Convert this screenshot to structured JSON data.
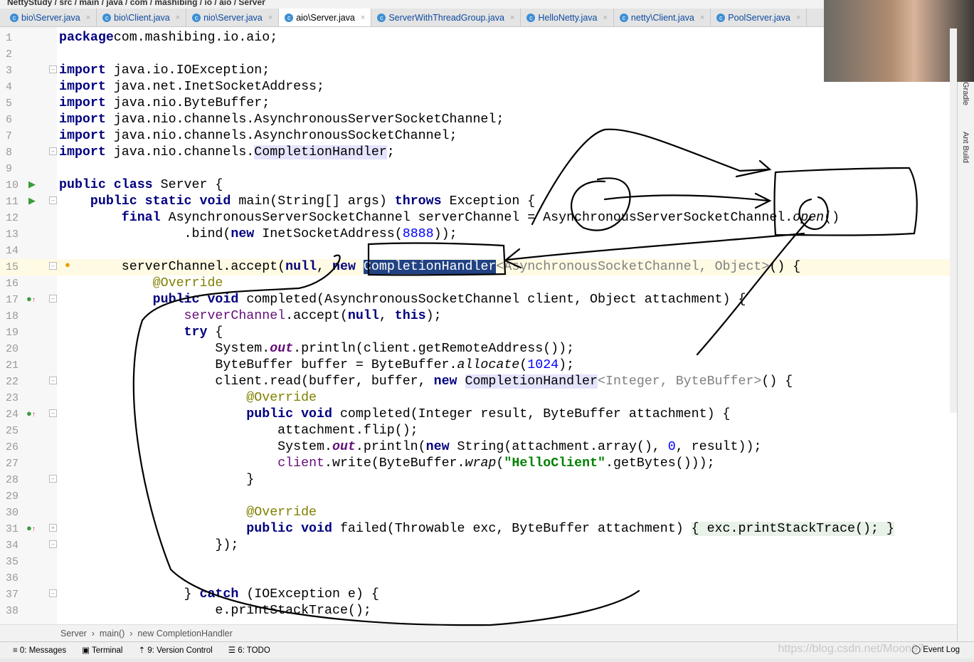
{
  "nav": "NettyStudy / src / main / java / com / mashibing / io / aio / Server",
  "tabs": [
    {
      "label": "bio\\Server.java"
    },
    {
      "label": "bio\\Client.java"
    },
    {
      "label": "nio\\Server.java"
    },
    {
      "label": "aio\\Server.java",
      "active": true
    },
    {
      "label": "ServerWithThreadGroup.java"
    },
    {
      "label": "HelloNetty.java"
    },
    {
      "label": "netty\\Client.java"
    },
    {
      "label": "PoolServer.java"
    }
  ],
  "code": [
    {
      "n": 1,
      "t": [
        [
          "kw",
          "package"
        ],
        [
          "",
          "com.mashibing.io.aio;"
        ]
      ]
    },
    {
      "n": 2,
      "t": []
    },
    {
      "n": 3,
      "t": [
        [
          "kw",
          "import"
        ],
        [
          "",
          " java.io.IOException;"
        ]
      ]
    },
    {
      "n": 4,
      "t": [
        [
          "kw",
          "import"
        ],
        [
          "",
          " java.net.InetSocketAddress;"
        ]
      ]
    },
    {
      "n": 5,
      "t": [
        [
          "kw",
          "import"
        ],
        [
          "",
          " java.nio.ByteBuffer;"
        ]
      ]
    },
    {
      "n": 6,
      "t": [
        [
          "kw",
          "import"
        ],
        [
          "",
          " java.nio.channels.AsynchronousServerSocketChannel;"
        ]
      ]
    },
    {
      "n": 7,
      "t": [
        [
          "kw",
          "import"
        ],
        [
          "",
          " java.nio.channels.AsynchronousSocketChannel;"
        ]
      ]
    },
    {
      "n": 8,
      "t": [
        [
          "kw",
          "import"
        ],
        [
          "",
          " java.nio.channels."
        ],
        [
          "hl",
          "CompletionHandler"
        ],
        [
          "",
          ";"
        ]
      ]
    },
    {
      "n": 9,
      "t": []
    },
    {
      "n": 10,
      "t": [
        [
          "kw",
          "public class"
        ],
        [
          "",
          " Server {"
        ]
      ]
    },
    {
      "n": 11,
      "t": [
        [
          "",
          "    "
        ],
        [
          "kw",
          "public static void"
        ],
        [
          "",
          " main(String[] args) "
        ],
        [
          "kw",
          "throws"
        ],
        [
          "",
          " Exception {"
        ]
      ]
    },
    {
      "n": 12,
      "t": [
        [
          "",
          "        "
        ],
        [
          "kw",
          "final"
        ],
        [
          "",
          " AsynchronousServerSocketChannel serverChannel = AsynchronousServerSocketChannel."
        ],
        [
          "it",
          "open"
        ],
        [
          "",
          "()"
        ]
      ]
    },
    {
      "n": 13,
      "t": [
        [
          "",
          "                .bind("
        ],
        [
          "kw",
          "new"
        ],
        [
          "",
          " InetSocketAddress("
        ],
        [
          "num",
          "8888"
        ],
        [
          "",
          "));"
        ]
      ]
    },
    {
      "n": 14,
      "t": []
    },
    {
      "n": 15,
      "t": [
        [
          "",
          "        serverChannel.accept("
        ],
        [
          "kw",
          "null"
        ],
        [
          "",
          ", "
        ],
        [
          "kw",
          "new"
        ],
        [
          "",
          " "
        ],
        [
          "sel",
          "CompletionHandler"
        ],
        [
          "gray",
          "<AsynchronousSocketChannel, Object>"
        ],
        [
          "",
          "() {"
        ]
      ],
      "cur": true
    },
    {
      "n": 16,
      "t": [
        [
          "",
          "            "
        ],
        [
          "ann",
          "@Override"
        ]
      ]
    },
    {
      "n": 17,
      "t": [
        [
          "",
          "            "
        ],
        [
          "kw",
          "public void"
        ],
        [
          "",
          " completed(AsynchronousSocketChannel client, Object attachment) {"
        ]
      ]
    },
    {
      "n": 18,
      "t": [
        [
          "",
          "                "
        ],
        [
          "field",
          "serverChannel"
        ],
        [
          "",
          ".accept("
        ],
        [
          "kw",
          "null"
        ],
        [
          "",
          ", "
        ],
        [
          "kw",
          "this"
        ],
        [
          "",
          ");"
        ]
      ]
    },
    {
      "n": 19,
      "t": [
        [
          "",
          "                "
        ],
        [
          "kw",
          "try"
        ],
        [
          "",
          " {"
        ]
      ]
    },
    {
      "n": 20,
      "t": [
        [
          "",
          "                    System."
        ],
        [
          "fit",
          "out"
        ],
        [
          "",
          ".println(client.getRemoteAddress());"
        ]
      ]
    },
    {
      "n": 21,
      "t": [
        [
          "",
          "                    ByteBuffer buffer = ByteBuffer."
        ],
        [
          "it",
          "allocate"
        ],
        [
          "",
          "("
        ],
        [
          "num",
          "1024"
        ],
        [
          "",
          ");"
        ]
      ]
    },
    {
      "n": 22,
      "t": [
        [
          "",
          "                    client.read(buffer, buffer, "
        ],
        [
          "kw",
          "new"
        ],
        [
          "",
          " "
        ],
        [
          "hl",
          "CompletionHandler"
        ],
        [
          "gray",
          "<Integer, ByteBuffer>"
        ],
        [
          "",
          "() {"
        ]
      ]
    },
    {
      "n": 23,
      "t": [
        [
          "",
          "                        "
        ],
        [
          "ann",
          "@Override"
        ]
      ]
    },
    {
      "n": 24,
      "t": [
        [
          "",
          "                        "
        ],
        [
          "kw",
          "public void"
        ],
        [
          "",
          " completed(Integer result, ByteBuffer attachment) {"
        ]
      ]
    },
    {
      "n": 25,
      "t": [
        [
          "",
          "                            attachment.flip();"
        ]
      ]
    },
    {
      "n": 26,
      "t": [
        [
          "",
          "                            System."
        ],
        [
          "fit",
          "out"
        ],
        [
          "",
          ".println("
        ],
        [
          "kw",
          "new"
        ],
        [
          "",
          " String(attachment.array(), "
        ],
        [
          "num",
          "0"
        ],
        [
          "",
          ", result));"
        ]
      ]
    },
    {
      "n": 27,
      "t": [
        [
          "",
          "                            "
        ],
        [
          "field",
          "client"
        ],
        [
          "",
          ".write(ByteBuffer."
        ],
        [
          "it",
          "wrap"
        ],
        [
          "",
          "("
        ],
        [
          "str",
          "\"HelloClient\""
        ],
        [
          "",
          ".getBytes()));"
        ]
      ]
    },
    {
      "n": 28,
      "t": [
        [
          "",
          "                        }"
        ]
      ]
    },
    {
      "n": 29,
      "t": []
    },
    {
      "n": 30,
      "t": [
        [
          "",
          "                        "
        ],
        [
          "ann",
          "@Override"
        ]
      ]
    },
    {
      "n": 31,
      "t": [
        [
          "",
          "                        "
        ],
        [
          "kw",
          "public void"
        ],
        [
          "",
          " failed(Throwable exc, ByteBuffer attachment) "
        ],
        [
          "fold",
          "{ exc.printStackTrace(); }"
        ]
      ]
    },
    {
      "n": 34,
      "t": [
        [
          "",
          "                    });"
        ]
      ]
    },
    {
      "n": 35,
      "t": []
    },
    {
      "n": 36,
      "t": []
    },
    {
      "n": 37,
      "t": [
        [
          "",
          "                } "
        ],
        [
          "kw",
          "catch"
        ],
        [
          "",
          " (IOException e) {"
        ]
      ]
    },
    {
      "n": 38,
      "t": [
        [
          "",
          "                    e.printStackTrace();"
        ]
      ]
    }
  ],
  "breadcrumb": [
    "Server",
    "main()",
    "new CompletionHandler"
  ],
  "tools": [
    {
      "label": "0: Messages",
      "icon": "messages-icon"
    },
    {
      "label": "Terminal",
      "icon": "terminal-icon"
    },
    {
      "label": "9: Version Control",
      "icon": "vcs-icon"
    },
    {
      "label": "6: TODO",
      "icon": "todo-icon"
    }
  ],
  "right_tools": [
    "Gradle",
    "Ant Build"
  ],
  "event_log": "Event Log",
  "watermark": "https://blog.csdn.net/Moon97"
}
